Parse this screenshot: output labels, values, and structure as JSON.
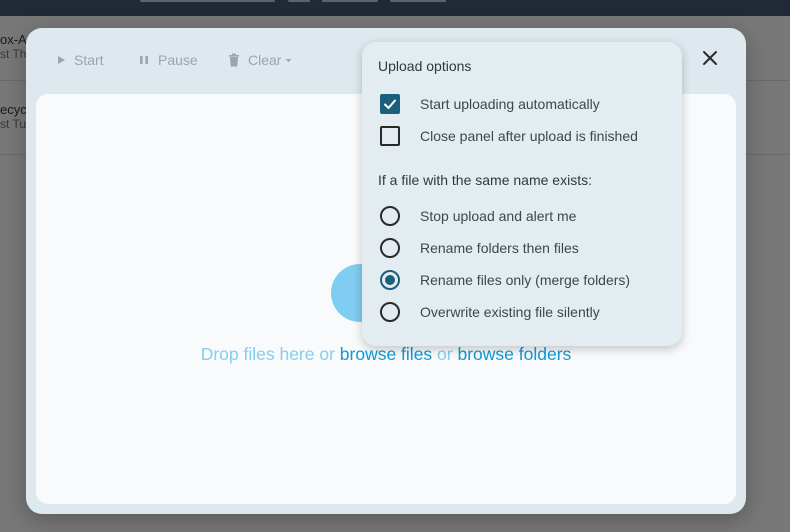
{
  "background": {
    "rows": [
      {
        "title": "ox-AC",
        "subtitle": "st Th"
      },
      {
        "title": "ecyc",
        "subtitle": "st Tu"
      }
    ]
  },
  "toolbar": {
    "start_label": "Start",
    "pause_label": "Pause",
    "clear_label": "Clear"
  },
  "dropzone": {
    "prefix": "Drop files here or ",
    "browse_files": "browse files",
    "middle": " or ",
    "browse_folders": "browse folders"
  },
  "options": {
    "title": "Upload options",
    "checkboxes": [
      {
        "label": "Start uploading automatically",
        "checked": true
      },
      {
        "label": "Close panel after upload is finished",
        "checked": false
      }
    ],
    "conflict_title": "If a file with the same name exists:",
    "radios": [
      {
        "label": "Stop upload and alert me",
        "checked": false
      },
      {
        "label": "Rename folders then files",
        "checked": false
      },
      {
        "label": "Rename files only (merge folders)",
        "checked": true
      },
      {
        "label": "Overwrite existing file silently",
        "checked": false
      }
    ]
  },
  "colors": {
    "accent": "#1a5f7e",
    "link": "#0f9ad6",
    "dialog_bg": "#dde9ee",
    "dropzone_bg": "#f8fafc"
  }
}
